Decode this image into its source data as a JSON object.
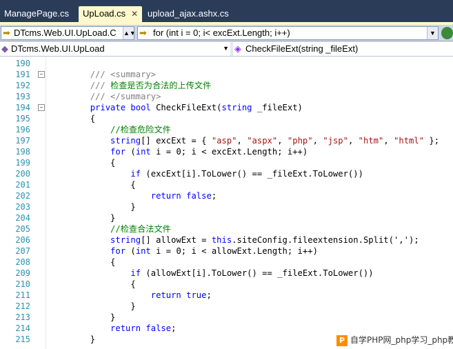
{
  "tabs": [
    {
      "label": "ManagePage.cs",
      "active": false
    },
    {
      "label": "UpLoad.cs",
      "active": true
    },
    {
      "label": "upload_ajax.ashx.cs",
      "active": false
    }
  ],
  "toolbar": {
    "class_combo": "DTcms.Web.UI.UpLoad.C",
    "member_combo": "for (int i = 0; i< excExt.Length; i++)"
  },
  "navbar": {
    "type_nav": "DTcms.Web.UI.UpLoad",
    "member_nav": "CheckFileExt(string _fileExt)"
  },
  "lines": [
    {
      "n": "190",
      "t": []
    },
    {
      "n": "191",
      "t": [
        {
          "c": "xt",
          "v": "        /// "
        },
        {
          "c": "xt",
          "v": "<summary>"
        }
      ],
      "fold": "−"
    },
    {
      "n": "192",
      "t": [
        {
          "c": "xt",
          "v": "        /// "
        },
        {
          "c": "cm",
          "v": "检查是否为合法的上传文件"
        }
      ]
    },
    {
      "n": "193",
      "t": [
        {
          "c": "xt",
          "v": "        /// </summary>"
        }
      ]
    },
    {
      "n": "194",
      "t": [
        {
          "c": "kw",
          "v": "        private bool "
        },
        {
          "c": "",
          "v": "CheckFileExt("
        },
        {
          "c": "kw",
          "v": "string"
        },
        {
          "c": "",
          "v": " _fileExt)"
        }
      ],
      "fold": "−"
    },
    {
      "n": "195",
      "t": [
        {
          "c": "",
          "v": "        {"
        }
      ]
    },
    {
      "n": "196",
      "t": [
        {
          "c": "cm",
          "v": "            //检查危险文件"
        }
      ]
    },
    {
      "n": "197",
      "t": [
        {
          "c": "kw",
          "v": "            string"
        },
        {
          "c": "",
          "v": "[] excExt = { "
        },
        {
          "c": "str",
          "v": "\"asp\""
        },
        {
          "c": "",
          "v": ", "
        },
        {
          "c": "str",
          "v": "\"aspx\""
        },
        {
          "c": "",
          "v": ", "
        },
        {
          "c": "str",
          "v": "\"php\""
        },
        {
          "c": "",
          "v": ", "
        },
        {
          "c": "str",
          "v": "\"jsp\""
        },
        {
          "c": "",
          "v": ", "
        },
        {
          "c": "str",
          "v": "\"htm\""
        },
        {
          "c": "",
          "v": ", "
        },
        {
          "c": "str",
          "v": "\"html\""
        },
        {
          "c": "",
          "v": " };"
        }
      ]
    },
    {
      "n": "198",
      "t": [
        {
          "c": "kw",
          "v": "            for"
        },
        {
          "c": "",
          "v": " ("
        },
        {
          "c": "kw",
          "v": "int"
        },
        {
          "c": "",
          "v": " i = 0; i < excExt.Length; i++)"
        }
      ]
    },
    {
      "n": "199",
      "t": [
        {
          "c": "",
          "v": "            {"
        }
      ]
    },
    {
      "n": "200",
      "t": [
        {
          "c": "kw",
          "v": "                if"
        },
        {
          "c": "",
          "v": " (excExt[i].ToLower() == _fileExt.ToLower())"
        }
      ]
    },
    {
      "n": "201",
      "t": [
        {
          "c": "",
          "v": "                {"
        }
      ]
    },
    {
      "n": "202",
      "t": [
        {
          "c": "kw",
          "v": "                    return false"
        },
        {
          "c": "",
          "v": ";"
        }
      ]
    },
    {
      "n": "203",
      "t": [
        {
          "c": "",
          "v": "                }"
        }
      ]
    },
    {
      "n": "204",
      "t": [
        {
          "c": "",
          "v": "            }"
        }
      ]
    },
    {
      "n": "205",
      "t": [
        {
          "c": "cm",
          "v": "            //检查合法文件"
        }
      ]
    },
    {
      "n": "206",
      "t": [
        {
          "c": "kw",
          "v": "            string"
        },
        {
          "c": "",
          "v": "[] allowExt = "
        },
        {
          "c": "kw",
          "v": "this"
        },
        {
          "c": "",
          "v": ".siteConfig.fileextension.Split(',');"
        }
      ]
    },
    {
      "n": "207",
      "t": [
        {
          "c": "kw",
          "v": "            for"
        },
        {
          "c": "",
          "v": " ("
        },
        {
          "c": "kw",
          "v": "int"
        },
        {
          "c": "",
          "v": " i = 0; i < allowExt.Length; i++)"
        }
      ]
    },
    {
      "n": "208",
      "t": [
        {
          "c": "",
          "v": "            {"
        }
      ]
    },
    {
      "n": "209",
      "t": [
        {
          "c": "kw",
          "v": "                if"
        },
        {
          "c": "",
          "v": " (allowExt[i].ToLower() == _fileExt.ToLower())"
        }
      ]
    },
    {
      "n": "210",
      "t": [
        {
          "c": "",
          "v": "                {"
        }
      ]
    },
    {
      "n": "211",
      "t": [
        {
          "c": "kw",
          "v": "                    return true"
        },
        {
          "c": "",
          "v": ";"
        }
      ]
    },
    {
      "n": "212",
      "t": [
        {
          "c": "",
          "v": "                }"
        }
      ]
    },
    {
      "n": "213",
      "t": [
        {
          "c": "",
          "v": "            }"
        }
      ]
    },
    {
      "n": "214",
      "t": [
        {
          "c": "kw",
          "v": "            return false"
        },
        {
          "c": "",
          "v": ";"
        }
      ]
    },
    {
      "n": "215",
      "t": [
        {
          "c": "",
          "v": "        }"
        }
      ]
    }
  ],
  "watermark": {
    "logo": "P",
    "text": "自学PHP网_php学习_php教"
  },
  "colors": {
    "keyword": "#0000ff",
    "comment": "#008000",
    "xmldoc": "#808080",
    "string": "#a31515",
    "line_number": "#2b91af",
    "tab_bar": "#2b3c59"
  }
}
